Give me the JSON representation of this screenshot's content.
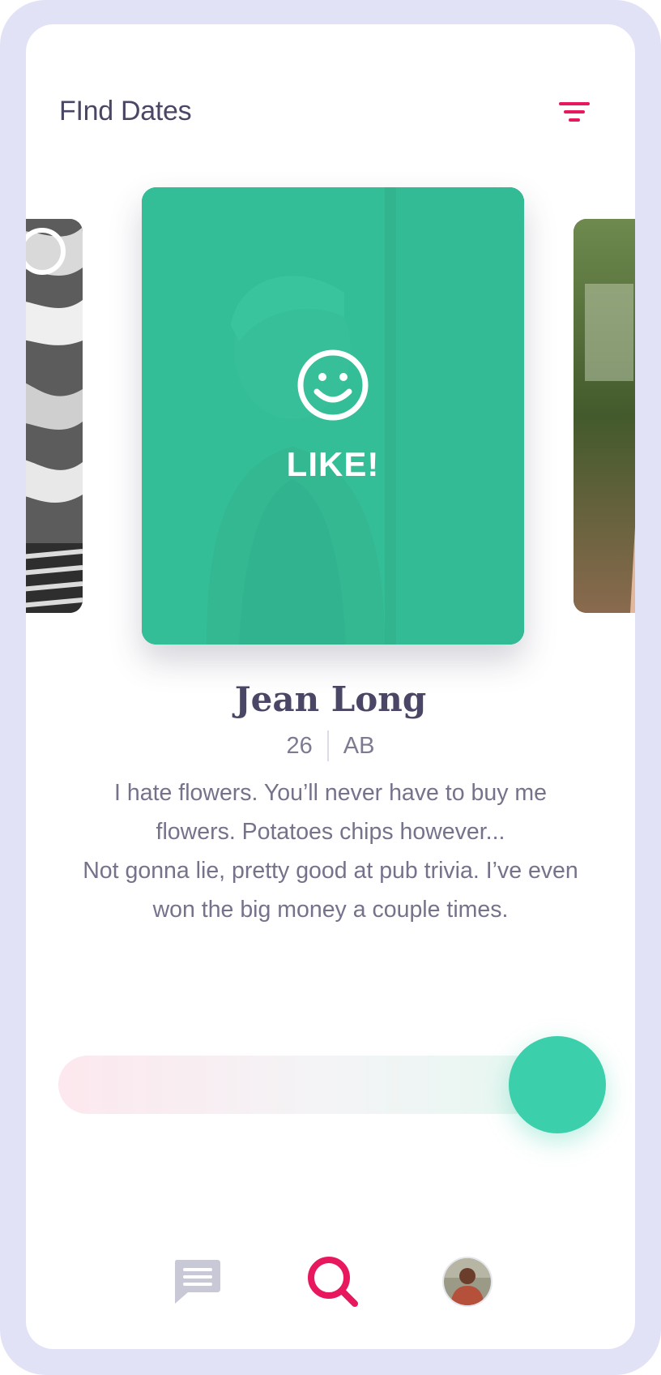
{
  "header": {
    "title": "FInd Dates",
    "filter_icon": "filter-icon"
  },
  "carousel": {
    "current_card": {
      "overlay_icon": "smile-icon",
      "overlay_label": "LIKE!"
    }
  },
  "profile": {
    "name": "Jean Long",
    "age": "26",
    "location": "AB",
    "bio_lines": [
      "I hate flowers. You’ll never have to buy me",
      "flowers. Potatoes chips however...",
      "Not gonna lie, pretty good at pub trivia. I’ve even",
      "won the big money a couple times."
    ]
  },
  "swipe_slider": {
    "position": 1.0
  },
  "bottom_nav": {
    "items": [
      "chat-icon",
      "search-icon",
      "avatar"
    ],
    "active": "search-icon"
  },
  "colors": {
    "accent_pink": "#e8185f",
    "like_green": "#3ccfab",
    "title_text": "#4a4766",
    "body_text": "#75738b",
    "frame": "#e2e2f6",
    "nav_inactive": "#c9c8d6"
  }
}
